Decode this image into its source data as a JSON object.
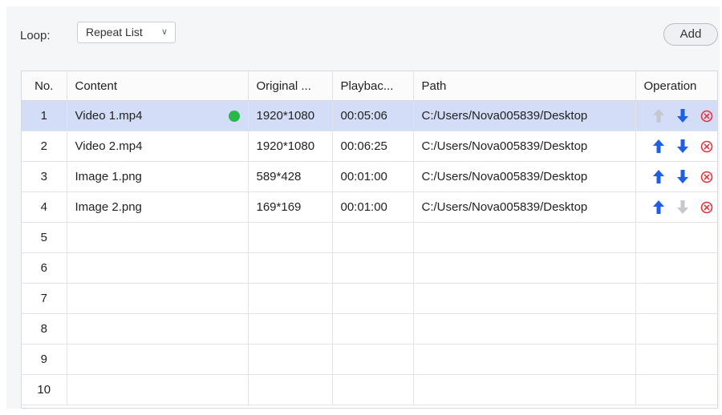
{
  "toolbar": {
    "loop_label": "Loop:",
    "loop_value": "Repeat List",
    "add_label": "Add"
  },
  "table": {
    "headers": {
      "no": "No.",
      "content": "Content",
      "original": "Original ...",
      "playback": "Playbac...",
      "path": "Path",
      "operation": "Operation"
    },
    "rows": [
      {
        "no": "1",
        "content": "Video 1.mp4",
        "original": "1920*1080",
        "playback": "00:05:06",
        "path": "C:/Users/Nova005839/Desktop",
        "selected": true,
        "status": "playing",
        "up_enabled": false,
        "down_enabled": true
      },
      {
        "no": "2",
        "content": "Video 2.mp4",
        "original": "1920*1080",
        "playback": "00:06:25",
        "path": "C:/Users/Nova005839/Desktop",
        "selected": false,
        "status": "",
        "up_enabled": true,
        "down_enabled": true
      },
      {
        "no": "3",
        "content": "Image 1.png",
        "original": "589*428",
        "playback": "00:01:00",
        "path": "C:/Users/Nova005839/Desktop",
        "selected": false,
        "status": "",
        "up_enabled": true,
        "down_enabled": true
      },
      {
        "no": "4",
        "content": "Image 2.png",
        "original": "169*169",
        "playback": "00:01:00",
        "path": "C:/Users/Nova005839/Desktop",
        "selected": false,
        "status": "",
        "up_enabled": true,
        "down_enabled": false
      },
      {
        "no": "5",
        "content": "",
        "original": "",
        "playback": "",
        "path": "",
        "selected": false,
        "status": "",
        "empty": true
      },
      {
        "no": "6",
        "content": "",
        "original": "",
        "playback": "",
        "path": "",
        "selected": false,
        "status": "",
        "empty": true
      },
      {
        "no": "7",
        "content": "",
        "original": "",
        "playback": "",
        "path": "",
        "selected": false,
        "status": "",
        "empty": true
      },
      {
        "no": "8",
        "content": "",
        "original": "",
        "playback": "",
        "path": "",
        "selected": false,
        "status": "",
        "empty": true
      },
      {
        "no": "9",
        "content": "",
        "original": "",
        "playback": "",
        "path": "",
        "selected": false,
        "status": "",
        "empty": true
      },
      {
        "no": "10",
        "content": "",
        "original": "",
        "playback": "",
        "path": "",
        "selected": false,
        "status": "",
        "empty": true
      }
    ]
  },
  "icons": {
    "up": "arrow-up-icon",
    "down": "arrow-down-icon",
    "delete": "delete-circle-icon",
    "status": "status-dot-icon"
  },
  "colors": {
    "accent": "#1f5fe8",
    "disabled": "#c4c8cf",
    "danger": "#e8323c",
    "status_playing": "#27b84a",
    "selected_row": "#d3ddf8"
  }
}
